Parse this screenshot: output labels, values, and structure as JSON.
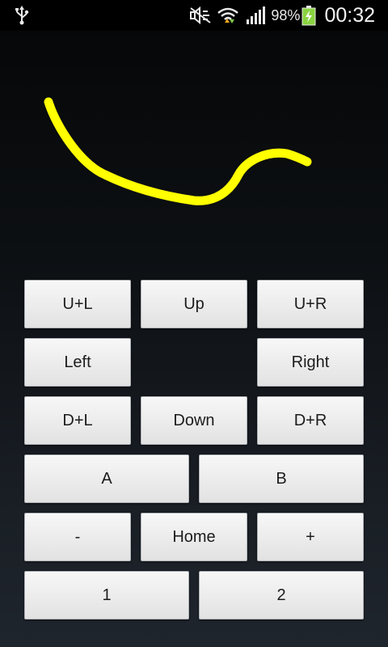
{
  "status_bar": {
    "battery_percent": "98%",
    "time": "00:32",
    "icons": [
      "usb-icon",
      "mute-icon",
      "wifi-icon",
      "signal-icon",
      "battery-charging-icon"
    ]
  },
  "drawing": {
    "stroke_color": "#ffff00",
    "background": "#0a0c0f"
  },
  "dpad": {
    "ul": "U+L",
    "up": "Up",
    "ur": "U+R",
    "left": "Left",
    "right": "Right",
    "dl": "D+L",
    "down": "Down",
    "dr": "D+R"
  },
  "actions": {
    "a": "A",
    "b": "B",
    "minus": "-",
    "home": "Home",
    "plus": "+",
    "one": "1",
    "two": "2"
  }
}
